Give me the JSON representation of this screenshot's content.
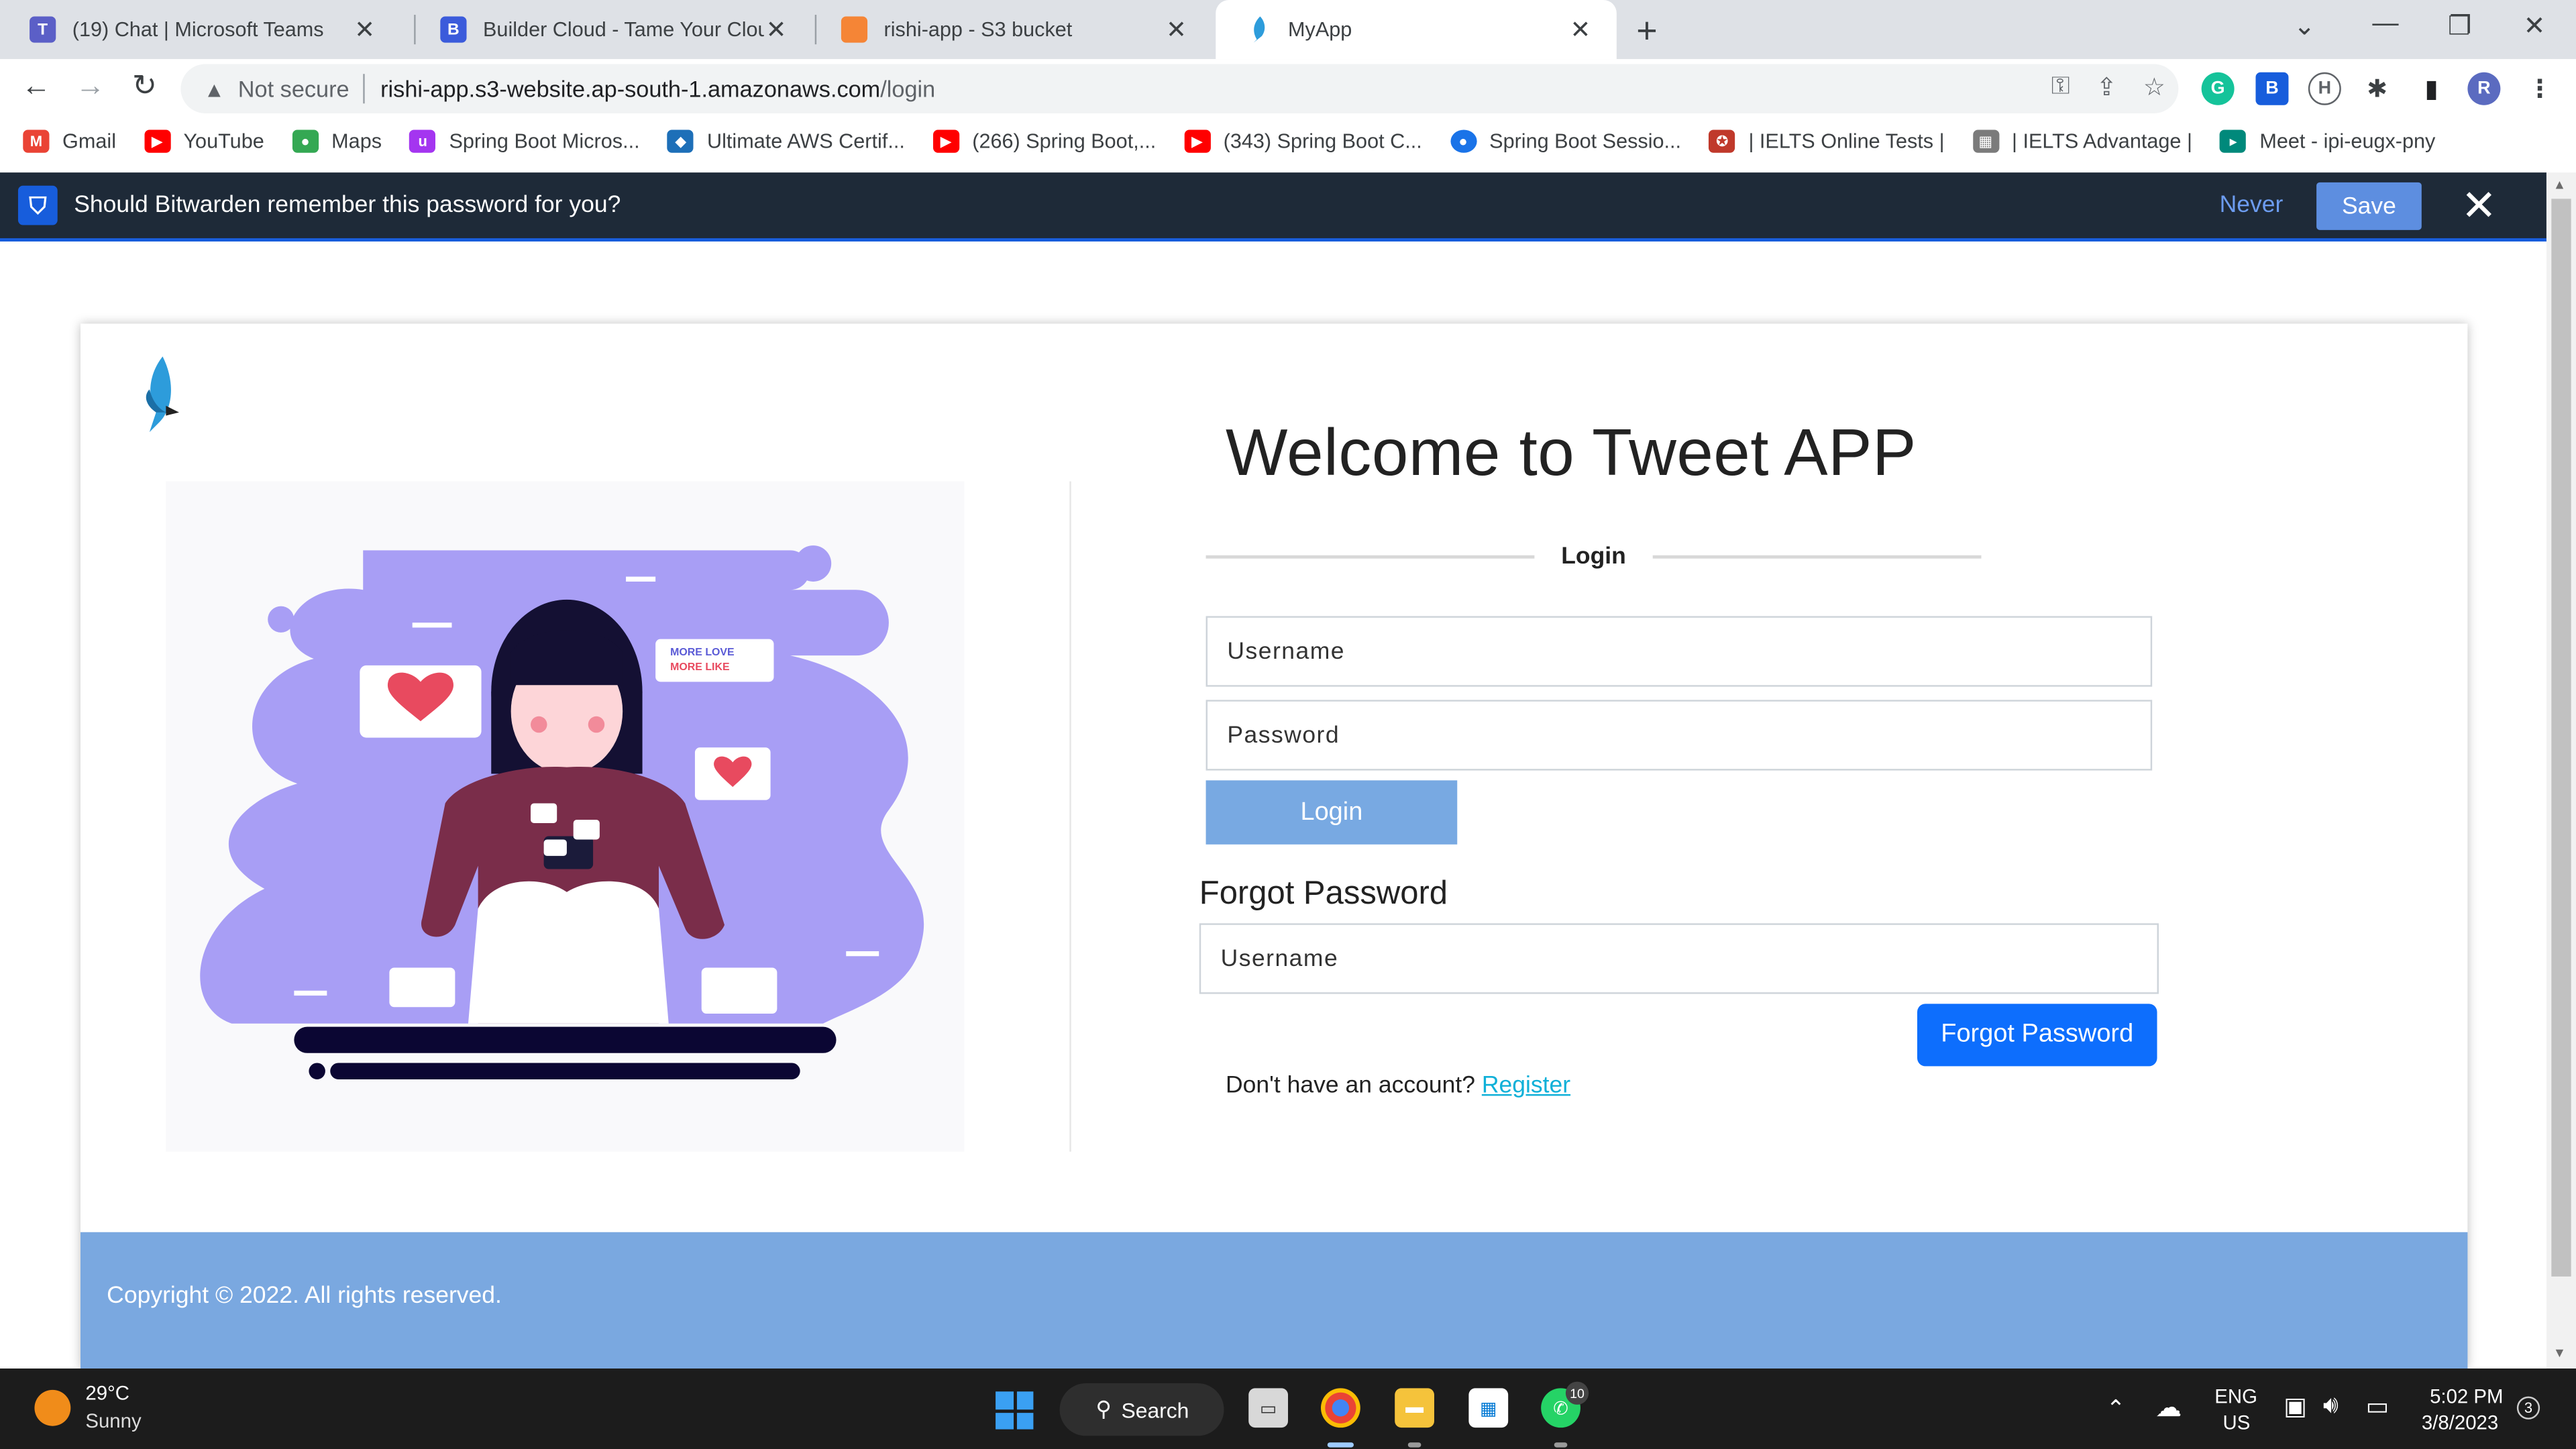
{
  "browser": {
    "tabs": [
      {
        "title": "(19) Chat | Microsoft Teams",
        "icon": "teams-icon",
        "color": "#5b5fc7"
      },
      {
        "title": "Builder Cloud - Tame Your Cloud",
        "icon": "builder-cloud-icon",
        "color": "#3b5bdb"
      },
      {
        "title": "rishi-app - S3 bucket",
        "icon": "aws-s3-icon",
        "color": "#f58536"
      },
      {
        "title": "MyApp",
        "icon": "bird-icon",
        "color": "#2d9cdb"
      }
    ],
    "security_label": "Not secure",
    "url_host": "rishi-app.s3-website.ap-south-1.amazonaws.com",
    "url_path": "/login",
    "profile_initial": "R"
  },
  "bookmarks": [
    {
      "label": "Gmail",
      "icon": "gmail-icon",
      "color": "#ea4335"
    },
    {
      "label": "YouTube",
      "icon": "youtube-icon",
      "color": "#ff0000"
    },
    {
      "label": "Maps",
      "icon": "maps-icon",
      "color": "#34a853"
    },
    {
      "label": "Spring Boot Micros...",
      "icon": "udemy-icon",
      "color": "#a435f0"
    },
    {
      "label": "Ultimate AWS Certif...",
      "icon": "aws-cert-icon",
      "color": "#1d6fb8"
    },
    {
      "label": "(266) Spring Boot,...",
      "icon": "youtube-icon",
      "color": "#ff0000"
    },
    {
      "label": "(343) Spring Boot C...",
      "icon": "youtube-icon",
      "color": "#ff0000"
    },
    {
      "label": "Spring Boot Sessio...",
      "icon": "session-icon",
      "color": "#1a73e8"
    },
    {
      "label": "| IELTS Online Tests |",
      "icon": "ielts-icon",
      "color": "#c0392b"
    },
    {
      "label": "| IELTS Advantage |",
      "icon": "ielts-advantage-icon",
      "color": "#7b7b7b"
    },
    {
      "label": "Meet - ipi-eugx-pny",
      "icon": "meet-icon",
      "color": "#00897b"
    }
  ],
  "bitwarden": {
    "message": "Should Bitwarden remember this password for you?",
    "never": "Never",
    "save": "Save"
  },
  "page": {
    "title": "Welcome to Tweet APP",
    "login_section": "Login",
    "username_placeholder": "Username",
    "password_placeholder": "Password",
    "login_button": "Login",
    "forgot_heading": "Forgot Password",
    "forgot_username_placeholder": "Username",
    "forgot_button": "Forgot Password",
    "no_account_text": "Don't have an account?",
    "register_link": "Register",
    "footer": "Copyright © 2022. All rights reserved.",
    "illustration_text": [
      "MORE LOVE",
      "MORE LIKE"
    ]
  },
  "taskbar": {
    "temperature": "29°C",
    "weather": "Sunny",
    "search": "Search",
    "whatsapp_badge": "10",
    "lang": "ENG",
    "region": "US",
    "time": "5:02 PM",
    "date": "3/8/2023",
    "notifications": "3"
  },
  "colors": {
    "accent": "#0d6efd",
    "login_button": "#78a9e2",
    "footer": "#7aa8e0",
    "illustration_purple": "#a89ef5",
    "bitwarden_bar": "#1e2a38"
  }
}
